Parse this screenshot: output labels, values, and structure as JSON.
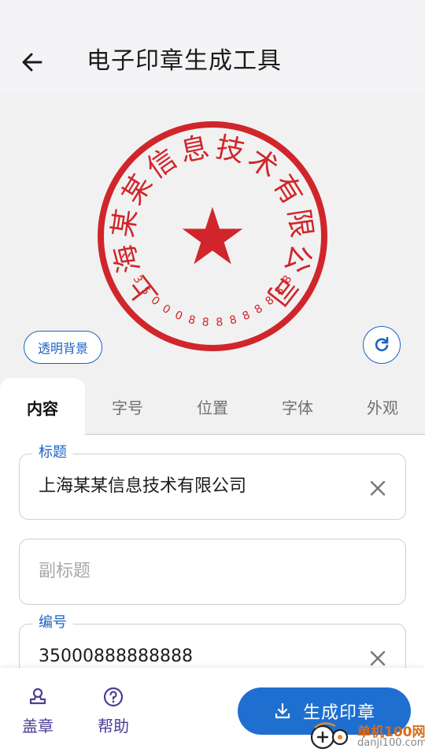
{
  "header": {
    "title": "电子印章生成工具",
    "back_icon": "arrow-left-icon"
  },
  "stamp": {
    "title_text": "上海某某信息技术有限公司",
    "number_text": "35000888888888",
    "center_symbol": "★",
    "color": "#d0262b",
    "transparent_bg_label": "透明背景",
    "refresh_icon": "refresh-icon"
  },
  "tabs": [
    {
      "label": "内容",
      "active": true
    },
    {
      "label": "字号",
      "active": false
    },
    {
      "label": "位置",
      "active": false
    },
    {
      "label": "字体",
      "active": false
    },
    {
      "label": "外观",
      "active": false
    }
  ],
  "form": {
    "title_field": {
      "label": "标题",
      "value": "上海某某信息技术有限公司"
    },
    "subtitle_field": {
      "placeholder": "副标题"
    },
    "number_field": {
      "label": "编号",
      "value": "35000888888888"
    }
  },
  "bottom": {
    "seal_label": "盖章",
    "help_label": "帮助",
    "generate_label": "生成印章"
  },
  "watermark": {
    "line1": "单机100网",
    "line2": "danji100.com"
  },
  "colors": {
    "accent": "#1b63c5",
    "button": "#1f6fd1",
    "nav": "#4a3f96",
    "stamp_red": "#d0262b"
  }
}
